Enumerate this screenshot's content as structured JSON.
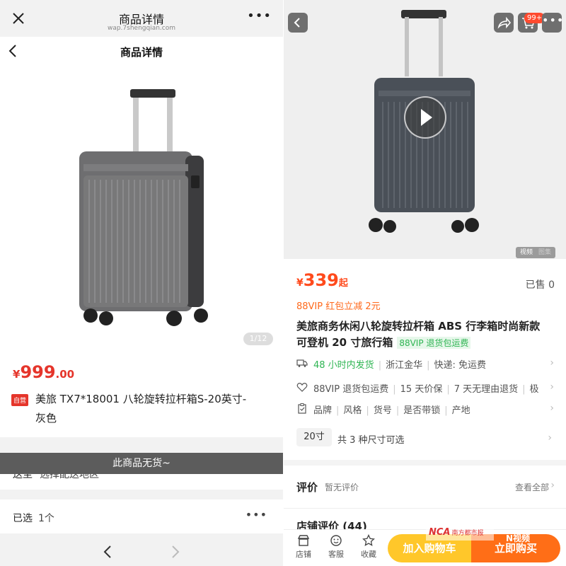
{
  "left": {
    "header": {
      "title": "商品详情",
      "url": "wap.7shengqian.com",
      "more": "•••"
    },
    "subheader": {
      "title": "商品详情"
    },
    "image_counter": "1/12",
    "price": {
      "currency": "¥",
      "integer": "999",
      "decimal": ".00"
    },
    "badge": "自营",
    "product_name_line1": "美旅 TX7*18001 八轮旋转拉杆箱S-20英寸-",
    "product_name_line2": "灰色",
    "shipping": {
      "label": "送至",
      "value": "选择配送地区",
      "more": "•••"
    },
    "stock_banner": "此商品无货~",
    "selected": {
      "label": "已选",
      "value": "1个",
      "more": "•••"
    }
  },
  "right": {
    "cart_badge": "99+",
    "more": "•••",
    "media_tabs": [
      "视频",
      "图集"
    ],
    "price": {
      "currency": "¥",
      "integer": "339",
      "suffix": "起"
    },
    "sold": "已售 0",
    "vip_promo": "88VIP 红包立减 2元",
    "title_line1": "美旅商务休闲八轮旋转拉杆箱 ABS 行李箱时尚新款",
    "title_line2": "可登机 20 寸旅行箱",
    "title_tag": "88VIP 退货包运费",
    "delivery": {
      "highlight": "48 小时内发货",
      "origin": "浙江金华",
      "express": "快递: 免运费"
    },
    "services": [
      "88VIP 退货包运费",
      "15 天价保",
      "7 天无理由退货",
      "极"
    ],
    "params": [
      "品牌",
      "风格",
      "货号",
      "是否带锁",
      "产地"
    ],
    "size": {
      "chip": "20寸",
      "text": "共 3 种尺寸可选"
    },
    "review": {
      "label": "评价",
      "none": "暂无评价",
      "all": "查看全部"
    },
    "shop_review": "店铺评价 (44)",
    "bottom_bar": {
      "shop": "店铺",
      "service": "客服",
      "fav": "收藏",
      "add_cart": "加入购物车",
      "buy_now": "立即购买"
    },
    "watermark": {
      "mark": "NCA",
      "text": "南方都市报",
      "video": "N视频"
    }
  },
  "colors": {
    "price_red": "#e5352b",
    "orange": "#ff6e17",
    "yellow": "#ffc72a",
    "green": "#2fb553"
  }
}
